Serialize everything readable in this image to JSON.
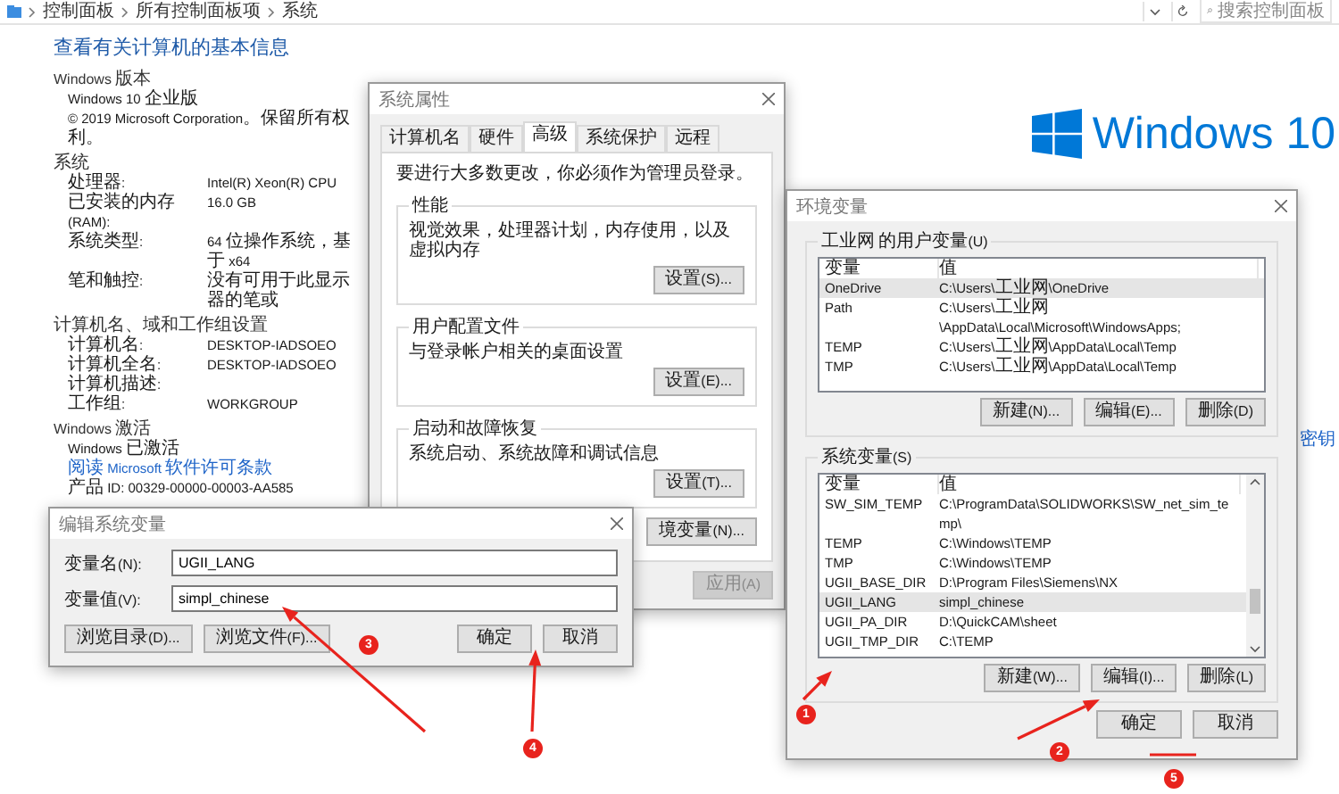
{
  "address_bar": {
    "breadcrumb": [
      "控制面板",
      "所有控制面板项",
      "系统"
    ],
    "search_placeholder": "搜索控制面板"
  },
  "page": {
    "title": "查看有关计算机的基本信息",
    "sections": [
      {
        "heading": "Windows 版本",
        "rows": [
          {
            "kind": "text",
            "text": "Windows 10 企业版"
          },
          {
            "kind": "text",
            "text": "© 2019 Microsoft Corporation。保留所有权利。"
          }
        ]
      },
      {
        "heading": "系统",
        "rows": [
          {
            "kind": "pair",
            "label": "处理器:",
            "value": "Intel(R) Xeon(R) CPU"
          },
          {
            "kind": "pair",
            "label": "已安装的内存(RAM):",
            "value": "16.0 GB"
          },
          {
            "kind": "pair",
            "label": "系统类型:",
            "value": "64 位操作系统，基于 x64"
          },
          {
            "kind": "pair",
            "label": "笔和触控:",
            "value": "没有可用于此显示器的笔或"
          }
        ]
      },
      {
        "heading": "计算机名、域和工作组设置",
        "rows": [
          {
            "kind": "pair",
            "label": "计算机名:",
            "value": "DESKTOP-IADSOEO"
          },
          {
            "kind": "pair",
            "label": "计算机全名:",
            "value": "DESKTOP-IADSOEO"
          },
          {
            "kind": "pair",
            "label": "计算机描述:"
          },
          {
            "kind": "pair",
            "label": "工作组:",
            "value": "WORKGROUP"
          }
        ]
      },
      {
        "heading": "Windows 激活",
        "rows": [
          {
            "kind": "link",
            "text": "Windows 已激活",
            "link": "阅读 Microsoft 软件许可条款"
          },
          {
            "kind": "text",
            "text": "产品 ID: 00329-00000-00003-AA585"
          }
        ]
      }
    ],
    "logo_text": "Windows 10",
    "side_link": "密钥"
  },
  "system_properties": {
    "title": "系统属性",
    "tabs": [
      {
        "label": "计算机名",
        "selected": false
      },
      {
        "label": "硬件",
        "selected": false
      },
      {
        "label": "高级",
        "selected": true
      },
      {
        "label": "系统保护",
        "selected": false
      },
      {
        "label": "远程",
        "selected": false
      }
    ],
    "notice": "要进行大多数更改，你必须作为管理员登录。",
    "groups": [
      {
        "legend": "性能",
        "text": "视觉效果，处理器计划，内存使用，以及虚拟内存",
        "button": "设置(S)..."
      },
      {
        "legend": "用户配置文件",
        "text": "与登录帐户相关的桌面设置",
        "button": "设置(E)..."
      },
      {
        "legend": "启动和故障恢复",
        "text": "系统启动、系统故障和调试信息",
        "button": "设置(T)..."
      }
    ],
    "env_button": "境变量(N)...",
    "footer_buttons": [
      {
        "label": "应用(A)",
        "disabled": true
      }
    ]
  },
  "environment_variables": {
    "title": "环境变量",
    "user_group": {
      "legend": "工业网 的用户变量(U)",
      "columns": [
        "变量",
        "值"
      ],
      "rows": [
        {
          "name": "OneDrive",
          "value": "C:\\Users\\工业网\\OneDrive",
          "selected": true
        },
        {
          "name": "Path",
          "value": "C:\\Users\\工业网\\AppData\\Local\\Microsoft\\WindowsApps;",
          "selected": false
        },
        {
          "name": "TEMP",
          "value": "C:\\Users\\工业网\\AppData\\Local\\Temp",
          "selected": false
        },
        {
          "name": "TMP",
          "value": "C:\\Users\\工业网\\AppData\\Local\\Temp",
          "selected": false
        }
      ],
      "buttons": [
        "新建(N)...",
        "编辑(E)...",
        "删除(D)"
      ]
    },
    "system_group": {
      "legend": "系统变量(S)",
      "columns": [
        "变量",
        "值"
      ],
      "rows": [
        {
          "name": "SW_SIM_TEMP",
          "value": "C:\\ProgramData\\SOLIDWORKS\\SW_net_sim_temp\\",
          "selected": false
        },
        {
          "name": "TEMP",
          "value": "C:\\Windows\\TEMP",
          "selected": false
        },
        {
          "name": "TMP",
          "value": "C:\\Windows\\TEMP",
          "selected": false
        },
        {
          "name": "UGII_BASE_DIR",
          "value": "D:\\Program Files\\Siemens\\NX",
          "selected": false
        },
        {
          "name": "UGII_LANG",
          "value": "simpl_chinese",
          "selected": true
        },
        {
          "name": "UGII_PA_DIR",
          "value": "D:\\QuickCAM\\sheet",
          "selected": false
        },
        {
          "name": "UGII_TMP_DIR",
          "value": "C:\\TEMP",
          "selected": false
        }
      ],
      "buttons": [
        "新建(W)...",
        "编辑(I)...",
        "删除(L)"
      ]
    },
    "footer_buttons": [
      "确定",
      "取消"
    ]
  },
  "edit_dialog": {
    "title": "编辑系统变量",
    "fields": [
      {
        "label": "变量名(N):",
        "value": "UGII_LANG"
      },
      {
        "label": "变量值(V):",
        "value": "simpl_chinese"
      }
    ],
    "browse_buttons": [
      "浏览目录(D)...",
      "浏览文件(F)..."
    ],
    "buttons": [
      "确定",
      "取消"
    ]
  },
  "annotations": [
    {
      "number": "1"
    },
    {
      "number": "2"
    },
    {
      "number": "3"
    },
    {
      "number": "4"
    },
    {
      "number": "5"
    }
  ]
}
